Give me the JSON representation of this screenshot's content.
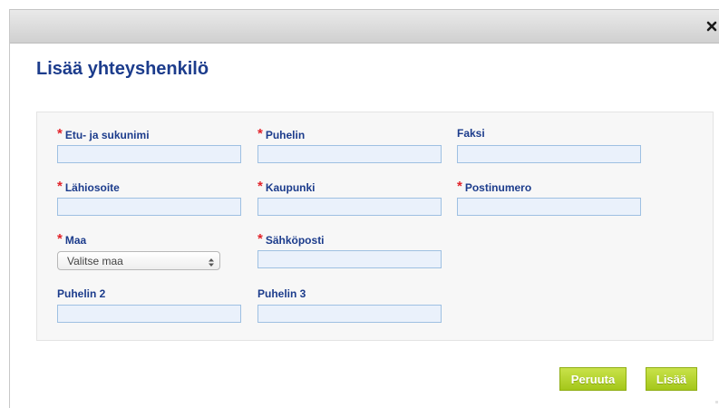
{
  "dialog": {
    "title": "Lisää yhteyshenkilö",
    "close_icon": "close-icon"
  },
  "form": {
    "fields": {
      "fullname": {
        "label": "Etu- ja sukunimi",
        "required": true,
        "value": ""
      },
      "phone": {
        "label": "Puhelin",
        "required": true,
        "value": ""
      },
      "fax": {
        "label": "Faksi",
        "required": false,
        "value": ""
      },
      "address": {
        "label": "Lähiosoite",
        "required": true,
        "value": ""
      },
      "city": {
        "label": "Kaupunki",
        "required": true,
        "value": ""
      },
      "postal_code": {
        "label": "Postinumero",
        "required": true,
        "value": ""
      },
      "country": {
        "label": "Maa",
        "required": true,
        "selected": "Valitse maa"
      },
      "email": {
        "label": "Sähköposti",
        "required": true,
        "value": ""
      },
      "phone2": {
        "label": "Puhelin 2",
        "required": false,
        "value": ""
      },
      "phone3": {
        "label": "Puhelin 3",
        "required": false,
        "value": ""
      }
    },
    "required_marker": "*"
  },
  "buttons": {
    "cancel": "Peruuta",
    "add": "Lisää"
  },
  "colors": {
    "title": "#1c3c8c",
    "label": "#1c3c8c",
    "required": "#e2232a",
    "input_bg": "#eaf1fb",
    "input_border": "#9ec0e2",
    "button": "#b4d22e"
  }
}
